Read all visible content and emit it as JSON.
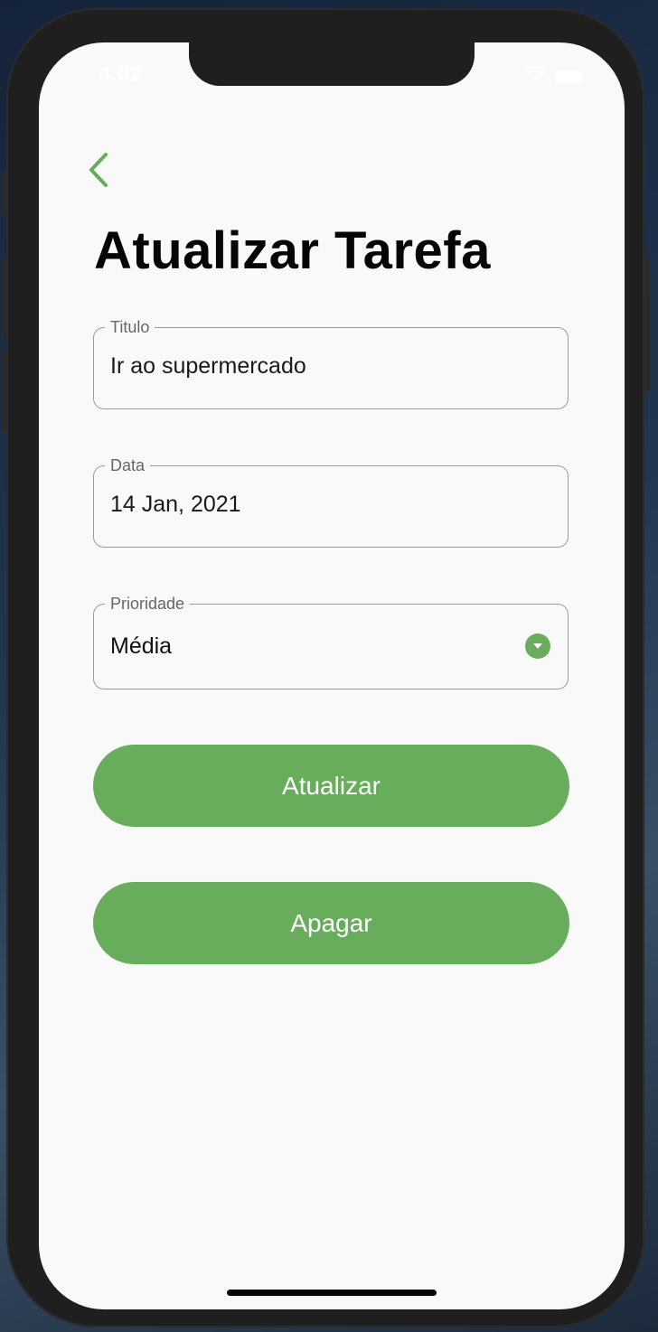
{
  "status_bar": {
    "time": "4:02"
  },
  "header": {
    "back_icon": "chevron-left-icon",
    "title": "Atualizar Tarefa"
  },
  "form": {
    "titulo": {
      "label": "Titulo",
      "value": "Ir ao supermercado"
    },
    "data": {
      "label": "Data",
      "value": "14 Jan, 2021"
    },
    "prioridade": {
      "label": "Prioridade",
      "value": "Média",
      "icon": "dropdown-arrow-icon"
    }
  },
  "actions": {
    "update_label": "Atualizar",
    "delete_label": "Apagar"
  },
  "colors": {
    "accent": "#67ad5b",
    "background": "#f9f9f9",
    "title_text": "#050505",
    "field_border": "#9b9b9b"
  }
}
